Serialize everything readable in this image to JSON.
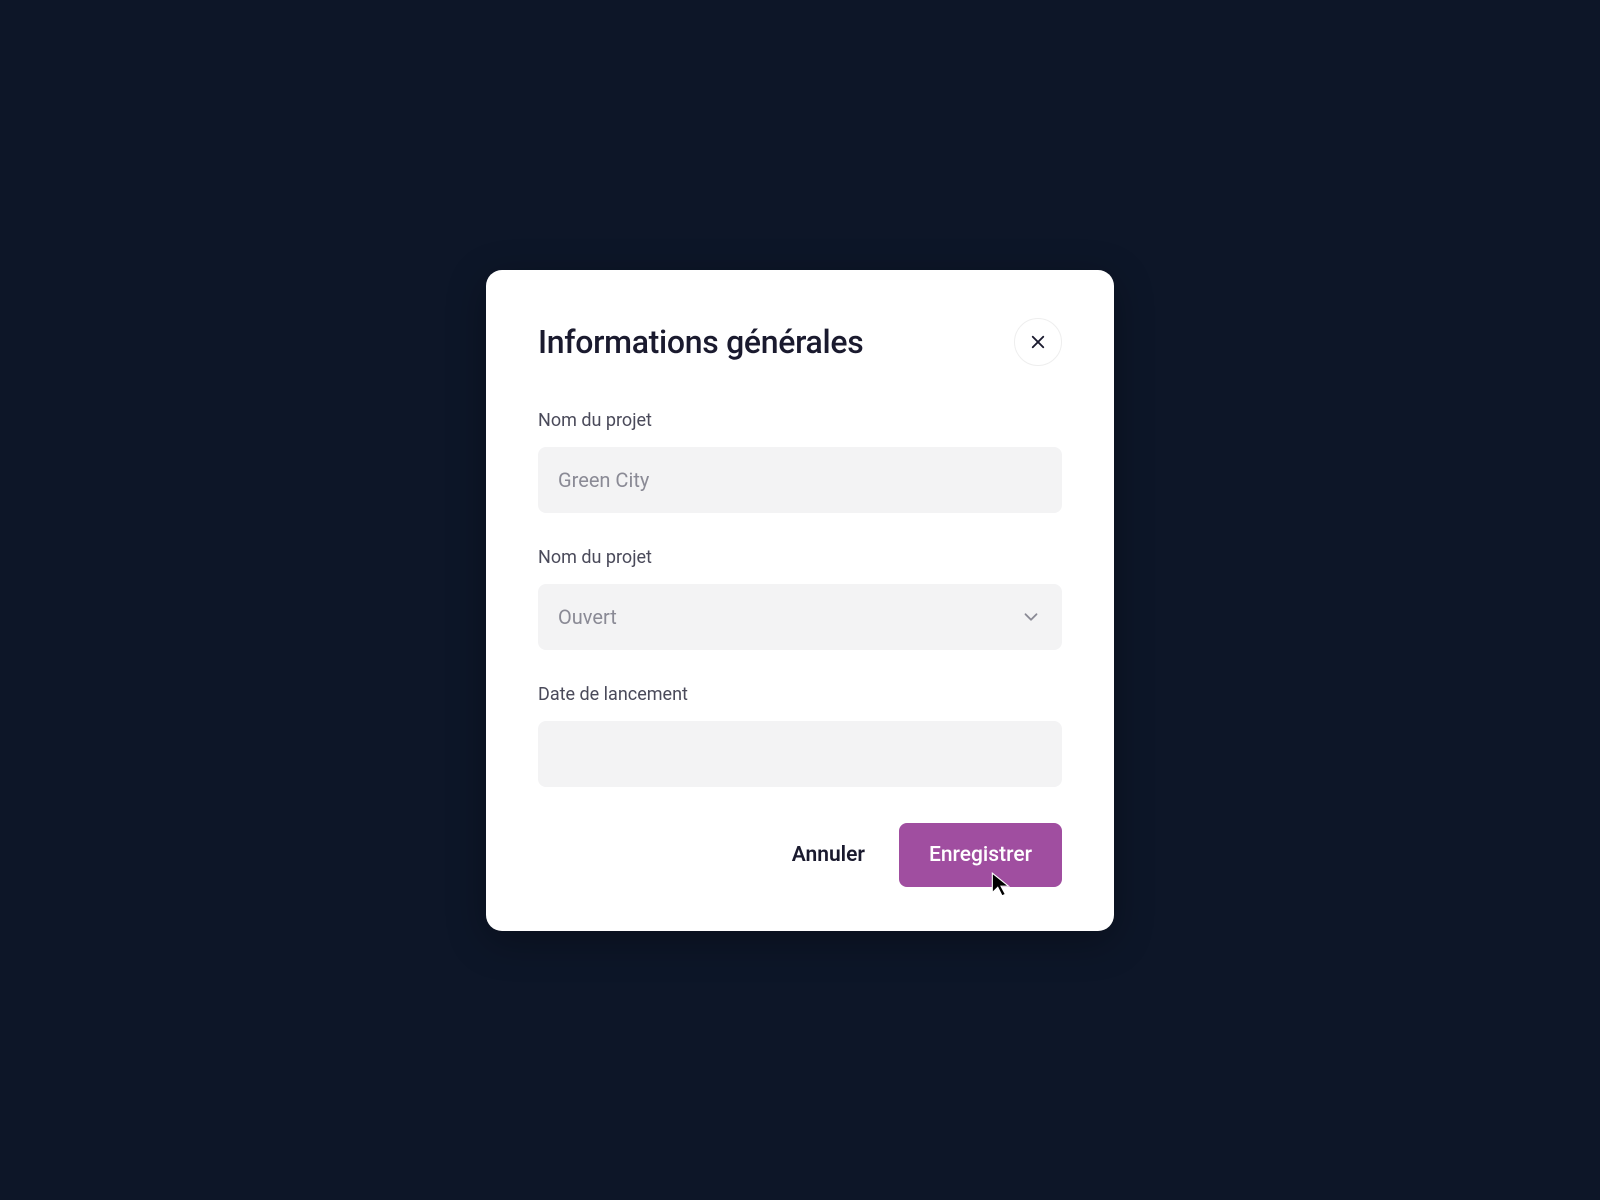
{
  "modal": {
    "title": "Informations générales",
    "fields": {
      "projectName": {
        "label": "Nom du projet",
        "value": "Green City"
      },
      "projectStatus": {
        "label": "Nom du projet",
        "selected": "Ouvert"
      },
      "launchDate": {
        "label": "Date de lancement",
        "value": ""
      }
    },
    "actions": {
      "cancel": "Annuler",
      "save": "Enregistrer"
    }
  },
  "colors": {
    "background": "#0d1628",
    "primary": "#a04ea0",
    "inputBg": "#f3f3f4"
  }
}
